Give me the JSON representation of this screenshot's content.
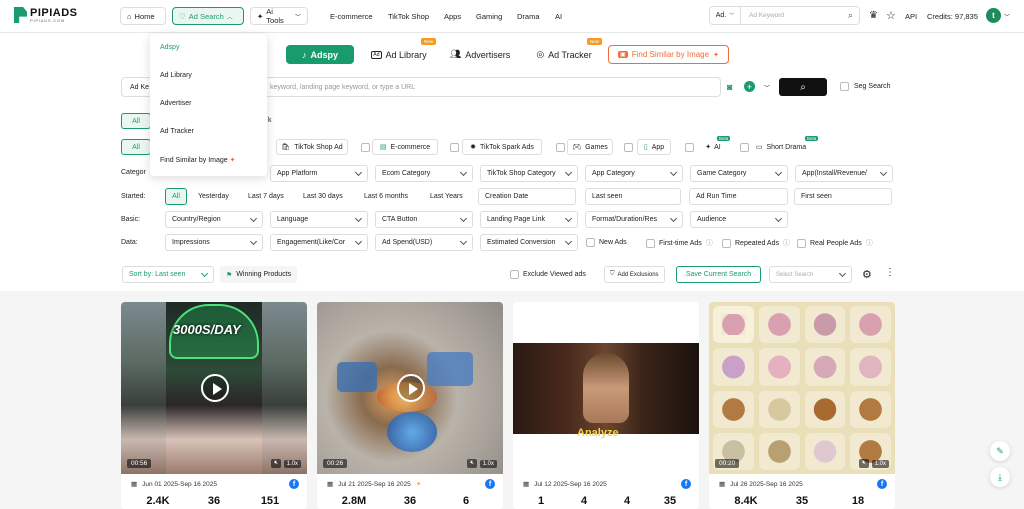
{
  "logo": {
    "title": "PIPIADS",
    "sub": "PIPIADS.COM"
  },
  "nav": {
    "home": "Home",
    "ad_search": "Ad Search",
    "ai_tools": "Ai Tools",
    "links": [
      "E-commerce",
      "TikTok Shop",
      "Apps",
      "Gaming",
      "Drama",
      "AI"
    ]
  },
  "top_search": {
    "select": "Ad.",
    "placeholder": "Ad Keyword"
  },
  "top_right": {
    "api": "API",
    "credits": "Credits: 97,835",
    "avatar": "t"
  },
  "dropdown": [
    "Adspy",
    "Ad Library",
    "Advertiser",
    "Ad Tracker",
    "Find Similar by Image"
  ],
  "tabs": {
    "adspy": "Adspy",
    "ad_library": "Ad Library",
    "advertisers": "Advertisers",
    "ad_tracker": "Ad Tracker",
    "find_similar": "Find Similar by Image",
    "new": "New"
  },
  "search": {
    "prefix": "Ad Ke",
    "placeholder": "keyword, landing page keyword, or type a URL",
    "seg": "Seg Search"
  },
  "row1": {
    "all": "All",
    "k": "k"
  },
  "platforms": {
    "all": "All",
    "items": [
      "TikTok Shop Ad",
      "E-commerce",
      "TikTok Spark Ads",
      "Games",
      "App",
      "AI",
      "Short Drama"
    ],
    "beta": "Beta"
  },
  "category_row": {
    "label": "Categor",
    "selects": [
      "App Platform",
      "Ecom Category",
      "TikTok Shop Category",
      "App Category",
      "Game Category",
      "App(Install/Revenue/"
    ]
  },
  "started_row": {
    "label": "Started:",
    "options": [
      "All",
      "Yesterday",
      "Last 7 days",
      "Last 30 days",
      "Last 6 months",
      "Last Years"
    ],
    "fields": [
      "Creation Date",
      "Last seen",
      "Ad Run Time",
      "First seen"
    ]
  },
  "basic_row": {
    "label": "Basic:",
    "selects": [
      "Country/Region",
      "Language",
      "CTA Button",
      "Landing Page Link",
      "Format/Duration/Res",
      "Audience"
    ]
  },
  "data_row": {
    "label": "Data:",
    "selects": [
      "Impressions",
      "Engagement(Like/Cor",
      "Ad Spend(USD)",
      "Estimated Conversion"
    ],
    "checks": [
      "New Ads",
      "First-time Ads",
      "Repeated Ads",
      "Real People Ads"
    ]
  },
  "sort_bar": {
    "sort": "Sort by: Last seen",
    "winning": "Winning Products",
    "exclude": "Exclude Viewed ads",
    "add_excl": "Add Exclusions",
    "save": "Save Current Search",
    "select_search": "Select Search"
  },
  "cards": [
    {
      "duration": "00:56",
      "date": "Jun 01 2025-Sep 16 2025",
      "stats": [
        "2.4K",
        "36",
        "151"
      ],
      "overlay": "3000S/DAY",
      "speed": "1.0x"
    },
    {
      "duration": "00:26",
      "date": "Jul 21 2025-Sep 16 2025",
      "stats": [
        "2.8M",
        "36",
        "6"
      ],
      "speed": "1.0x"
    },
    {
      "duration": "",
      "date": "Jul 12 2025-Sep 16 2025",
      "stats": [
        "1",
        "4",
        "4",
        "35"
      ],
      "overlay": "Analyze"
    },
    {
      "duration": "00:20",
      "date": "Jul 26 2025-Sep 16 2025",
      "stats": [
        "8.4K",
        "35",
        "18"
      ],
      "speed": "1.0x"
    }
  ],
  "colors": {
    "brand": "#1a9b6c",
    "orange": "#f26b3a",
    "fb": "#1877f2"
  }
}
